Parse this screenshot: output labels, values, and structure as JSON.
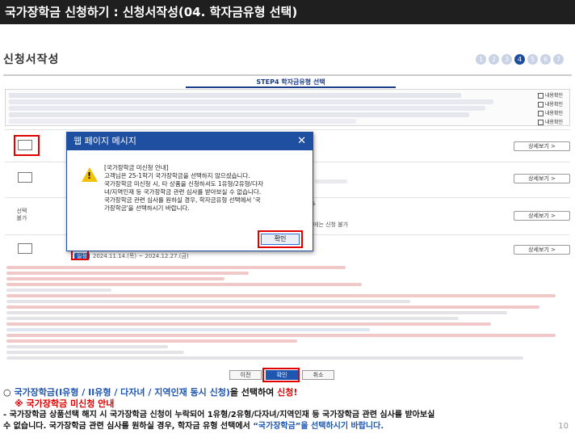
{
  "header": {
    "title": "국가장학금 신청하기 : 신청서작성(04. 학자금유형 선택)"
  },
  "page": {
    "heading": "신청서작성",
    "page_number": "10"
  },
  "steps": {
    "items": [
      "1",
      "2",
      "3",
      "4",
      "5",
      "6",
      "7"
    ],
    "active": "4"
  },
  "form": {
    "step_title": "STEP4 학자금유형 선택",
    "agree_check_label": "내용확인",
    "detail_button_label": "상세보기 >",
    "select_label": "선택\n불가",
    "row_note_1": "%",
    "row_note_2": "에는 신청 불가",
    "apply_tag": "일정",
    "apply_date": "2024.11.14.(목) ~ 2024.12.27.(금)",
    "buttons": {
      "prev": "이전",
      "confirm": "확인",
      "cancel": "취소"
    }
  },
  "dialog": {
    "title": "웹 페이지 메시지",
    "close": "✕",
    "message_title": "[국가장학금 미신청 안내]",
    "message_lines": [
      "고객님은 25-1학기 국가장학금을 선택하지 않으셨습니다.",
      "국가장학금 미신청 시, 타 상품을 신청하셔도 1유형/2유형/다자",
      "녀/지역인재 등 국가장학금 관련 심사를 받아보실 수 없습니다.",
      "국가장학금 관련 심사를 원하실 경우, 학자금유형 선택에서 '국",
      "가장학금'을 선택하시기 바랍니다."
    ],
    "ok_label": "확인"
  },
  "caption": {
    "prefix": "○ ",
    "line1_blue": "국가장학금(I유형 / II유형 / 다자녀 / 지역인재 동시 신청)",
    "line1_mid": "을 선택하여 ",
    "line1_red": "신청!",
    "line2": "※ 국가장학금 미신청 안내",
    "line3": "- 국가장학금 상품선택 해지 시 국가장학금 신청이 누락되어 1유형/2유형/다자녀/지역인재 등 국가장학금 관련 심사를 받아보실",
    "line4_a": "수 없습니다. 국가장학금 관련 심사를 원하실 경우, 학자금 유형 선택에서 ",
    "line4_blue": "“국가장학금”을 선택하시기 바랍니다."
  },
  "colors": {
    "titlebar": "#1f1f1f",
    "brand_blue": "#1e56b0",
    "highlight_red": "#e00000",
    "dialog_blue": "#1e4fa0"
  }
}
